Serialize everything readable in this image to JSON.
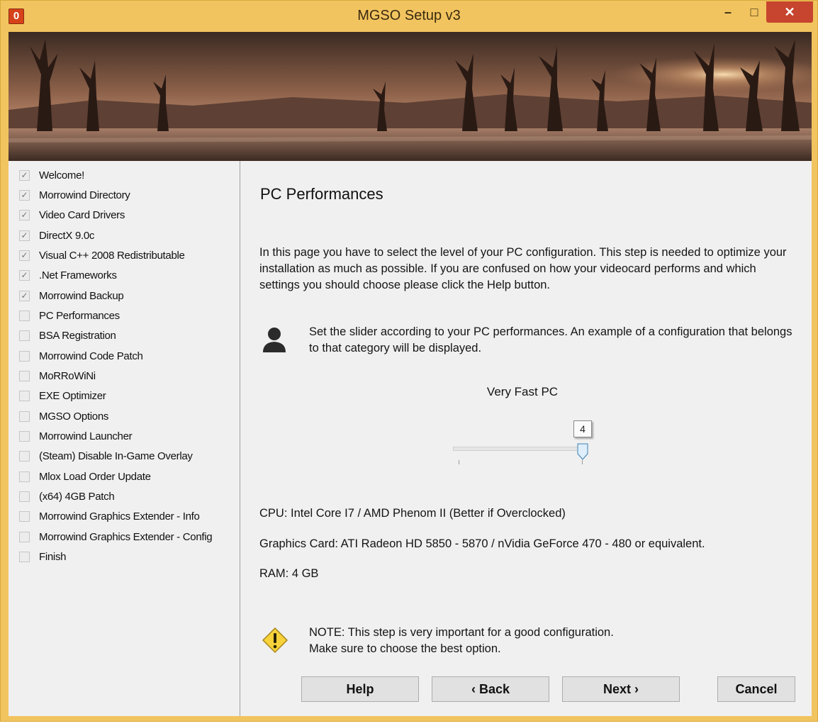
{
  "window": {
    "title": "MGSO Setup v3",
    "icon_letter": "0",
    "controls": {
      "minimize": "–",
      "maximize": "□",
      "close": "✕"
    },
    "accent_color": "#f2c45f",
    "close_color": "#c7442e"
  },
  "sidebar": {
    "steps": [
      {
        "label": "Welcome!",
        "checked": true
      },
      {
        "label": "Morrowind Directory",
        "checked": true
      },
      {
        "label": "Video Card Drivers",
        "checked": true
      },
      {
        "label": "DirectX 9.0c",
        "checked": true
      },
      {
        "label": "Visual C++ 2008 Redistributable",
        "checked": true
      },
      {
        "label": ".Net Frameworks",
        "checked": true
      },
      {
        "label": "Morrowind Backup",
        "checked": true
      },
      {
        "label": "PC Performances",
        "checked": false
      },
      {
        "label": "BSA Registration",
        "checked": false
      },
      {
        "label": "Morrowind Code Patch",
        "checked": false
      },
      {
        "label": "MoRRoWiNi",
        "checked": false
      },
      {
        "label": "EXE Optimizer",
        "checked": false
      },
      {
        "label": "MGSO Options",
        "checked": false
      },
      {
        "label": "Morrowind Launcher",
        "checked": false
      },
      {
        "label": "(Steam) Disable In-Game Overlay",
        "checked": false
      },
      {
        "label": "Mlox Load Order Update",
        "checked": false
      },
      {
        "label": "(x64) 4GB Patch",
        "checked": false
      },
      {
        "label": "Morrowind Graphics Extender - Info",
        "checked": false
      },
      {
        "label": "Morrowind Graphics Extender - Config",
        "checked": false
      },
      {
        "label": "Finish",
        "checked": false
      }
    ]
  },
  "main": {
    "title": "PC Performances",
    "intro": "In this page you have to select the level of your PC configuration. This step is needed to optimize your installation as much as possible. If you are confused on how your videocard performs and which settings you should choose please click the Help button.",
    "hint": "Set the slider according to your PC performances. An example of a configuration that belongs to that category will be displayed.",
    "level_label": "Very Fast PC",
    "slider": {
      "value": "4",
      "max": 4
    },
    "specs": {
      "cpu": "CPU: Intel Core I7 / AMD Phenom II (Better if Overclocked)",
      "gpu": "Graphics Card: ATI Radeon HD 5850 - 5870 / nVidia GeForce 470 - 480 or equivalent.",
      "ram": "RAM: 4 GB"
    },
    "note": {
      "line1": "NOTE: This step is very important for a good configuration.",
      "line2": "Make sure to choose the best option."
    }
  },
  "buttons": {
    "help": "Help",
    "back": "‹ Back",
    "next": "Next ›",
    "cancel": "Cancel"
  }
}
